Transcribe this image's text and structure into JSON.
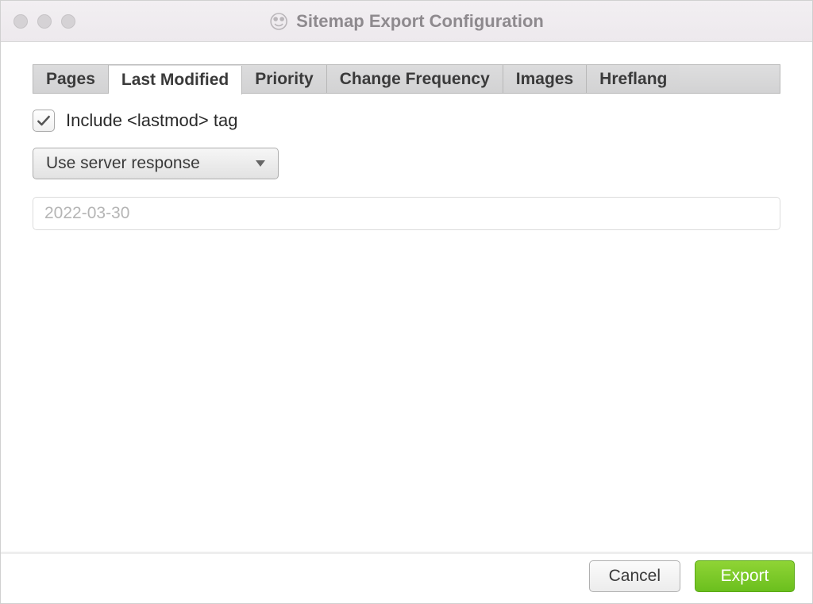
{
  "window": {
    "title": "Sitemap Export Configuration"
  },
  "tabs": [
    {
      "label": "Pages",
      "active": false
    },
    {
      "label": "Last Modified",
      "active": true
    },
    {
      "label": "Priority",
      "active": false
    },
    {
      "label": "Change Frequency",
      "active": false
    },
    {
      "label": "Images",
      "active": false
    },
    {
      "label": "Hreflang",
      "active": false
    }
  ],
  "lastModified": {
    "checkboxLabel": "Include <lastmod> tag",
    "checked": true,
    "dropdownValue": "Use server response",
    "dateValue": "2022-03-30"
  },
  "footer": {
    "cancelLabel": "Cancel",
    "exportLabel": "Export"
  }
}
